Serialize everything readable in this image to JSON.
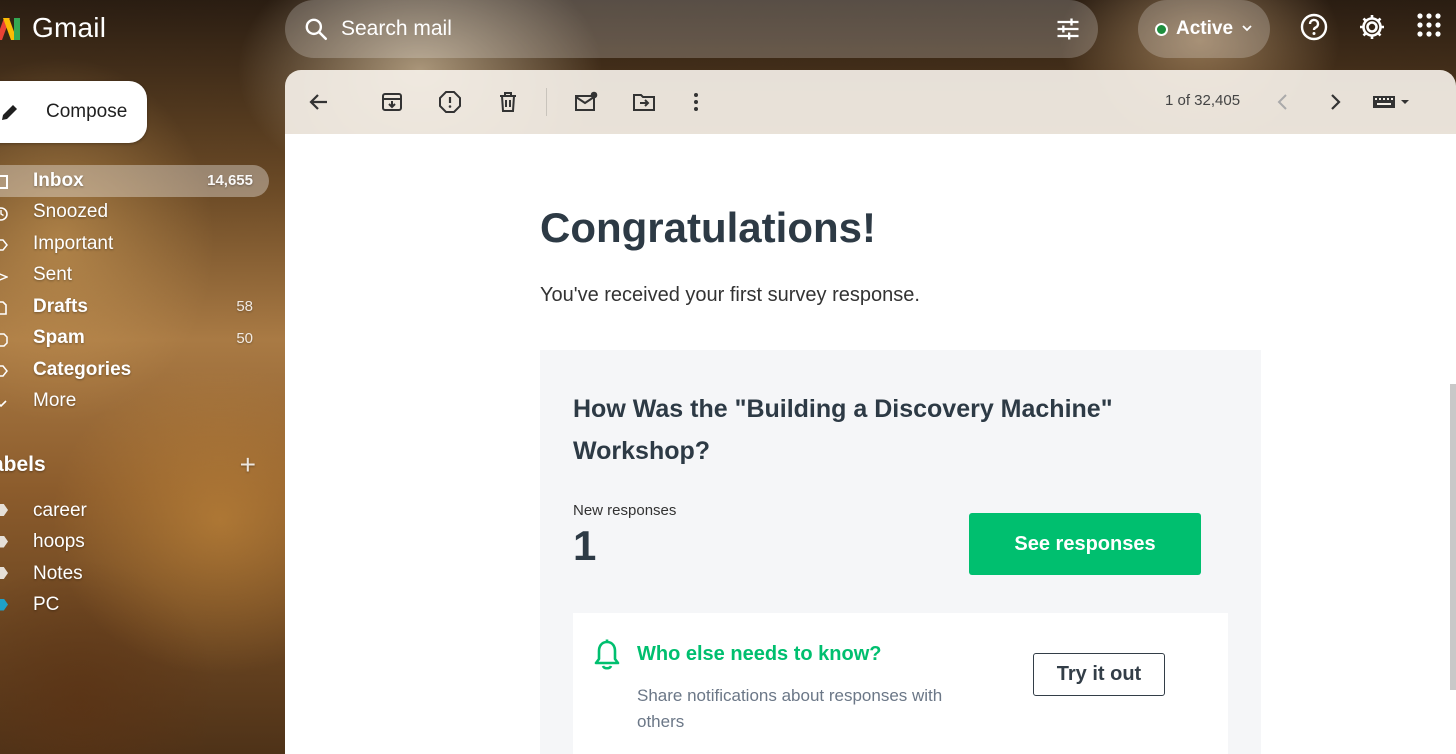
{
  "app": {
    "name": "Gmail"
  },
  "search": {
    "placeholder": "Search mail"
  },
  "status": {
    "label": "Active",
    "color": "#1e8e3e"
  },
  "sidebar": {
    "compose_label": "Compose",
    "items": [
      {
        "label": "Inbox",
        "count": "14,655",
        "icon": "inbox-icon"
      },
      {
        "label": "Snoozed",
        "count": "",
        "icon": "clock-icon"
      },
      {
        "label": "Important",
        "count": "",
        "icon": "label-important-icon"
      },
      {
        "label": "Sent",
        "count": "",
        "icon": "send-icon"
      },
      {
        "label": "Drafts",
        "count": "58",
        "icon": "draft-icon"
      },
      {
        "label": "Spam",
        "count": "50",
        "icon": "spam-icon"
      },
      {
        "label": "Categories",
        "count": "",
        "icon": "label-icon"
      },
      {
        "label": "More",
        "count": "",
        "icon": "chevron-down-icon"
      }
    ],
    "labels_header": "abels",
    "labels": [
      {
        "label": "career",
        "color": "#e6e0d8"
      },
      {
        "label": "hoops",
        "color": "#e6e0d8"
      },
      {
        "label": "Notes",
        "color": "#e6e0d8"
      },
      {
        "label": "PC",
        "color": "#1ea1c9"
      }
    ]
  },
  "toolbar": {
    "pager": "1 of 32,405"
  },
  "email": {
    "heading": "Congratulations!",
    "subline": "You've received your first survey response.",
    "survey_title": "How Was the \"Building a Discovery Machine\" Workshop?",
    "new_responses_label": "New responses",
    "new_responses_value": "1",
    "see_responses_button": "See responses",
    "notify_heading": "Who else needs to know?",
    "notify_text": "Share notifications about responses with others",
    "try_button": "Try it out",
    "accent_color": "#00bf6f"
  }
}
